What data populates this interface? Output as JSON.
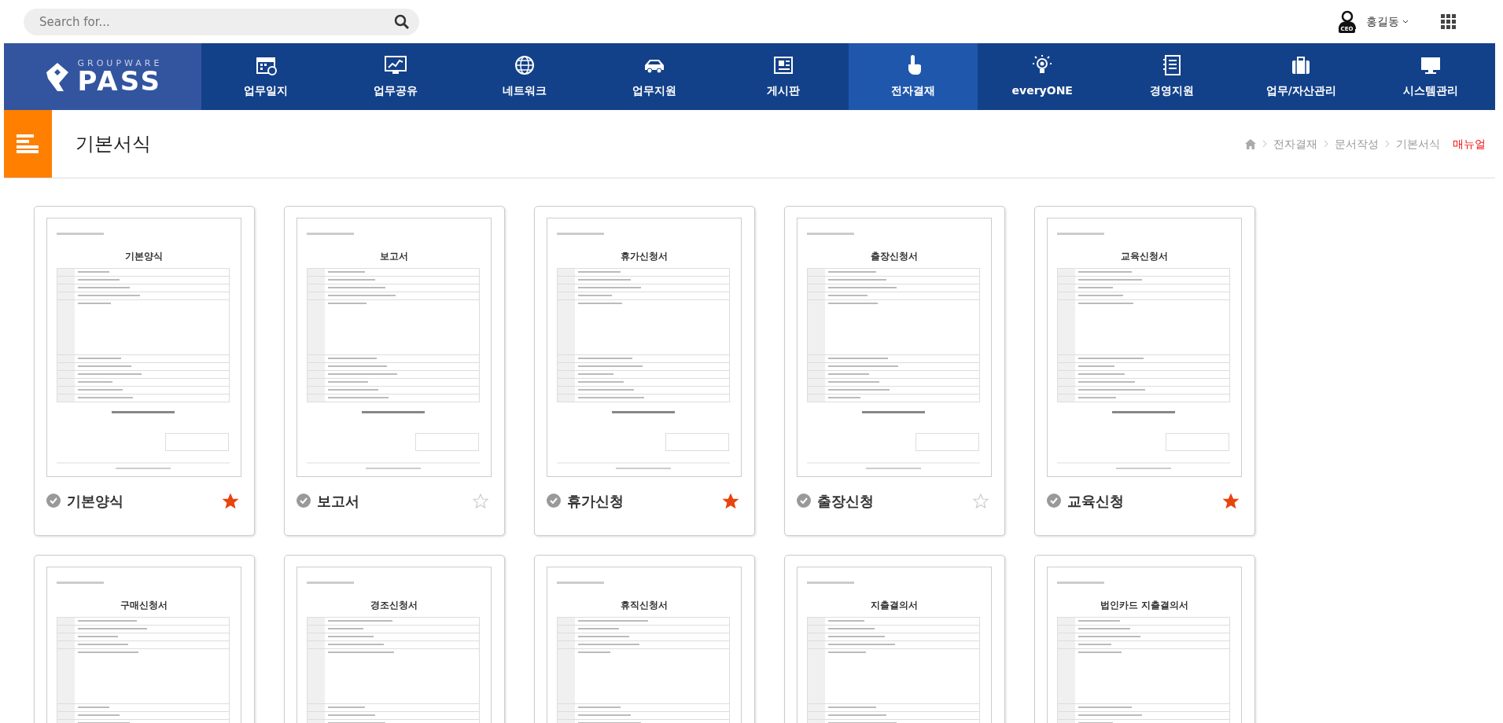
{
  "search": {
    "placeholder": "Search for..."
  },
  "user": {
    "name": "홍길동",
    "badge": "CEO"
  },
  "logo": {
    "tagline": "GROUPWARE",
    "name": "PASS"
  },
  "nav": [
    {
      "label": "업무일지",
      "selected": false
    },
    {
      "label": "업무공유",
      "selected": false
    },
    {
      "label": "네트워크",
      "selected": false
    },
    {
      "label": "업무지원",
      "selected": false
    },
    {
      "label": "게시판",
      "selected": false
    },
    {
      "label": "전자결재",
      "selected": true
    },
    {
      "label": "everyONE",
      "selected": false
    },
    {
      "label": "경영지원",
      "selected": false
    },
    {
      "label": "업무/자산관리",
      "selected": false
    },
    {
      "label": "시스템관리",
      "selected": false
    }
  ],
  "page_title": "기본서식",
  "breadcrumb": [
    "전자결재",
    "문서작성",
    "기본서식"
  ],
  "manual_link": "매뉴얼",
  "forms": [
    {
      "preview_title": "기본양식",
      "title": "기본양식",
      "favorite": true
    },
    {
      "preview_title": "보고서",
      "title": "보고서",
      "favorite": false
    },
    {
      "preview_title": "휴가신청서",
      "title": "휴가신청",
      "favorite": true
    },
    {
      "preview_title": "출장신청서",
      "title": "출장신청",
      "favorite": false
    },
    {
      "preview_title": "교육신청서",
      "title": "교육신청",
      "favorite": true
    },
    {
      "preview_title": "구매신청서"
    },
    {
      "preview_title": "경조신청서"
    },
    {
      "preview_title": "휴직신청서"
    },
    {
      "preview_title": "지출결의서"
    },
    {
      "preview_title": "법인카드 지출결의서"
    }
  ]
}
